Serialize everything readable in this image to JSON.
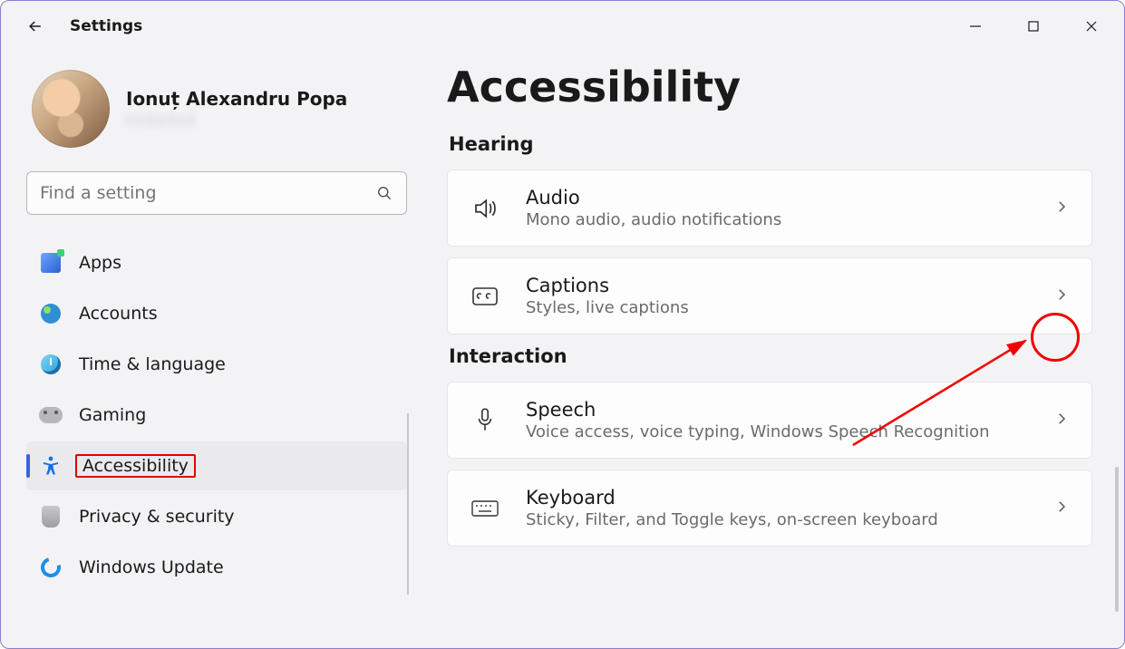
{
  "app": {
    "title": "Settings"
  },
  "profile": {
    "name": "Ionuț Alexandru Popa",
    "email": "redacted"
  },
  "search": {
    "placeholder": "Find a setting"
  },
  "nav": {
    "items": [
      {
        "id": "apps",
        "label": "Apps"
      },
      {
        "id": "accounts",
        "label": "Accounts"
      },
      {
        "id": "time-language",
        "label": "Time & language"
      },
      {
        "id": "gaming",
        "label": "Gaming"
      },
      {
        "id": "accessibility",
        "label": "Accessibility"
      },
      {
        "id": "privacy",
        "label": "Privacy & security"
      },
      {
        "id": "update",
        "label": "Windows Update"
      }
    ],
    "selected": "accessibility"
  },
  "page": {
    "title": "Accessibility",
    "sections": [
      {
        "label": "Hearing",
        "cards": [
          {
            "id": "audio",
            "title": "Audio",
            "sub": "Mono audio, audio notifications"
          },
          {
            "id": "captions",
            "title": "Captions",
            "sub": "Styles, live captions"
          }
        ]
      },
      {
        "label": "Interaction",
        "cards": [
          {
            "id": "speech",
            "title": "Speech",
            "sub": "Voice access, voice typing, Windows Speech Recognition"
          },
          {
            "id": "keyboard",
            "title": "Keyboard",
            "sub": "Sticky, Filter, and Toggle keys, on-screen keyboard"
          }
        ]
      }
    ]
  },
  "annotation": {
    "target": "captions",
    "kind": "circle-with-arrow",
    "color": "#f20000"
  }
}
